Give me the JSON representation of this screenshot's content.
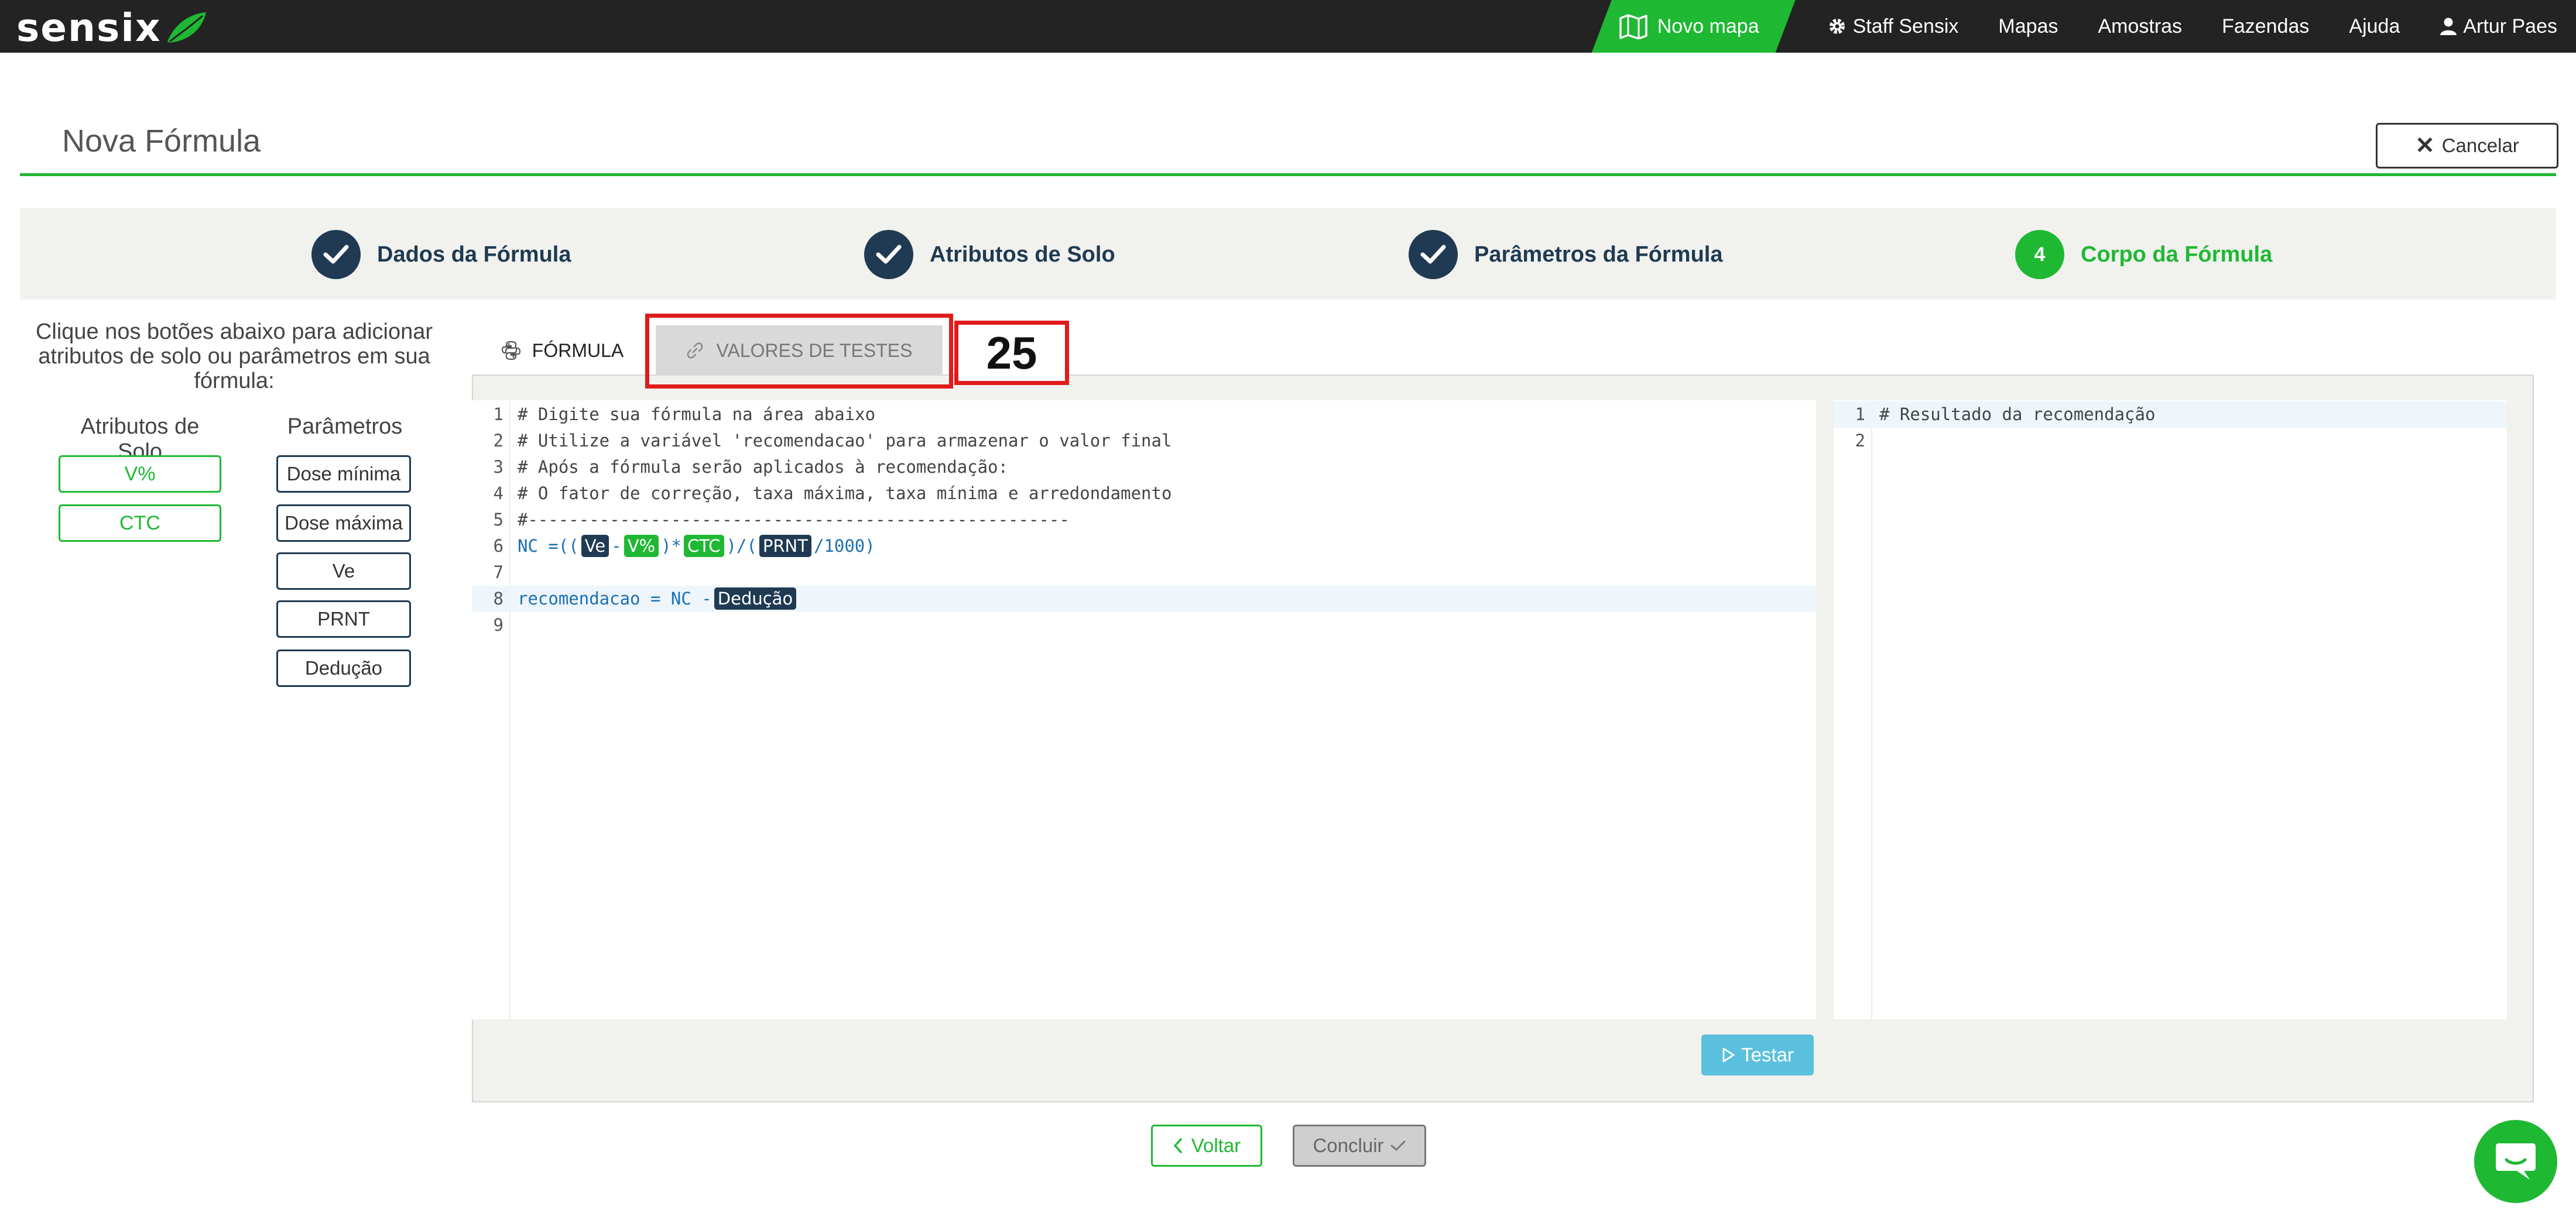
{
  "navbar": {
    "logo": "sensix",
    "novo_mapa": "Novo mapa",
    "links": [
      "Staff Sensix",
      "Mapas",
      "Amostras",
      "Fazendas",
      "Ajuda"
    ],
    "user": "Artur Paes"
  },
  "header": {
    "title": "Nova Fórmula",
    "cancel_label": "Cancelar"
  },
  "steps": [
    {
      "label": "Dados da Fórmula",
      "state": "done"
    },
    {
      "label": "Atributos de Solo",
      "state": "done"
    },
    {
      "label": "Parâmetros da Fórmula",
      "state": "done"
    },
    {
      "label": "Corpo da Fórmula",
      "state": "active",
      "number": "4"
    }
  ],
  "left_panel": {
    "hint": "Clique nos botões abaixo para adicionar atributos de solo ou parâmetros em sua fórmula:",
    "attributes_header": "Atributos de Solo",
    "parameters_header": "Parâmetros",
    "attributes": [
      "V%",
      "CTC"
    ],
    "parameters": [
      "Dose mínima",
      "Dose máxima",
      "Ve",
      "PRNT",
      "Dedução"
    ]
  },
  "tabs": {
    "formula": "FÓRMULA",
    "valores": "VALORES DE TESTES",
    "annotation": "25"
  },
  "editor": {
    "line_numbers": [
      "1",
      "2",
      "3",
      "4",
      "5",
      "6",
      "7",
      "8",
      "9"
    ],
    "comments": [
      "# Digite sua fórmula na área abaixo",
      "# Utilize a variável 'recomendacao' para armazenar o valor final",
      "# Após a fórmula serão aplicados à recomendação:",
      "# O fator de correção, taxa máxima, taxa mínima e arredondamento",
      "#-----------------------------------------------------"
    ],
    "line6": {
      "var": "NC",
      "eq": "=((",
      "tok1": "Ve",
      "minus": "-",
      "tok2": "V%",
      "mul": ")*",
      "tok3": "CTC",
      "div": ")/(",
      "tok4": "PRNT",
      "tail": "/1000)"
    },
    "line8": {
      "var": "recomendacao",
      "eq": "=",
      "nc": "NC",
      "minus": "-",
      "tok": "Dedução"
    }
  },
  "result": {
    "line_numbers": [
      "1",
      "2"
    ],
    "comment": "# Resultado da recomendação"
  },
  "actions": {
    "testar": "Testar",
    "voltar": "Voltar",
    "concluir": "Concluir"
  },
  "colors": {
    "brand_green": "#1fb833",
    "navy": "#1f3a52",
    "navbar": "#232323",
    "highlight_red": "#e01b1b",
    "testar_blue": "#5bc0de"
  }
}
